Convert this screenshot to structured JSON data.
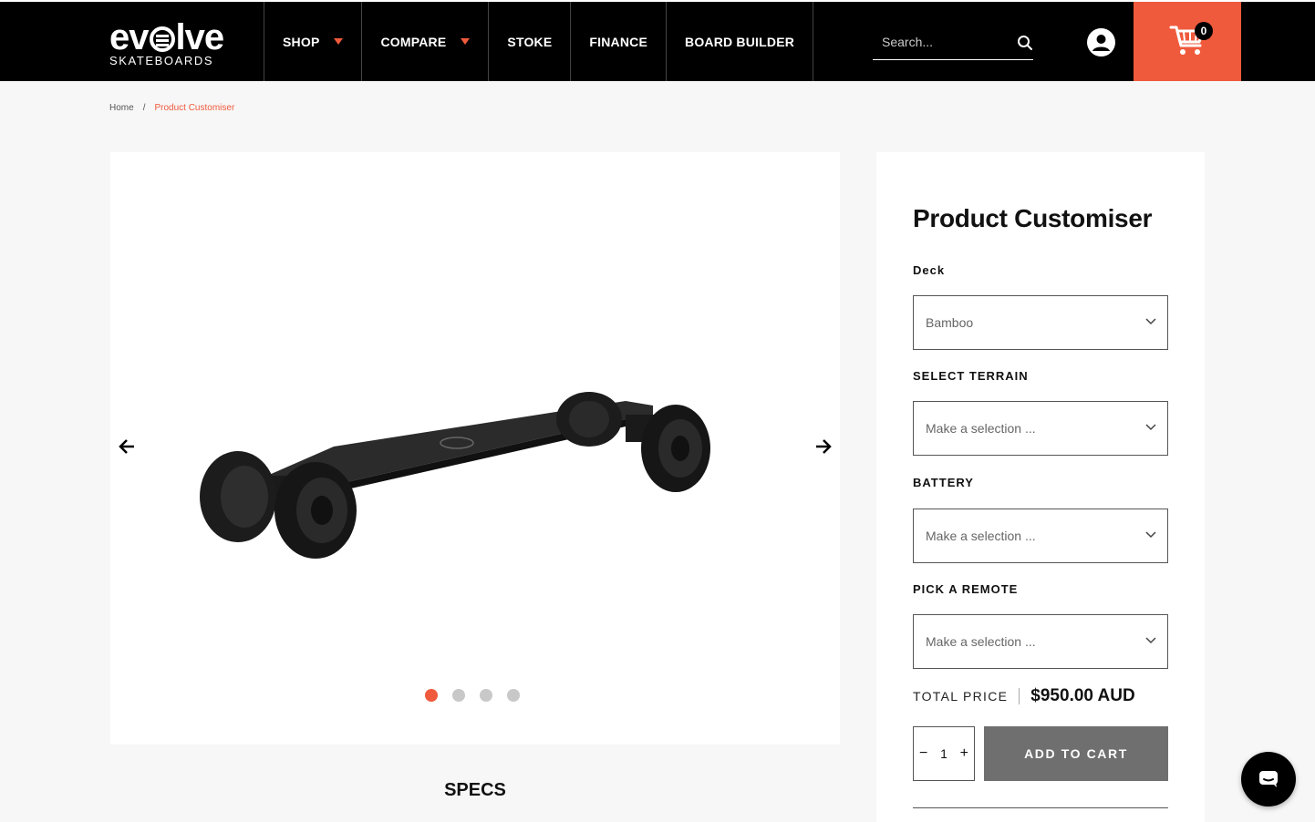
{
  "brand": {
    "name": "evolve",
    "sub": "SKATEBOARDS"
  },
  "nav": [
    {
      "label": "SHOP",
      "dropdown": true
    },
    {
      "label": "COMPARE",
      "dropdown": true
    },
    {
      "label": "STOKE",
      "dropdown": false
    },
    {
      "label": "FINANCE",
      "dropdown": false
    },
    {
      "label": "BOARD BUILDER",
      "dropdown": false
    }
  ],
  "search": {
    "placeholder": "Search..."
  },
  "cart": {
    "count": "0"
  },
  "breadcrumb": {
    "home": "Home",
    "separator": "/",
    "current": "Product Customiser"
  },
  "gallery": {
    "slides": 4,
    "active_slide": 1
  },
  "specs": {
    "heading": "SPECS"
  },
  "customiser": {
    "title": "Product Customiser",
    "fields": [
      {
        "label": "Deck",
        "value": "Bamboo"
      },
      {
        "label": "SELECT TERRAIN",
        "value": "Make a selection ..."
      },
      {
        "label": "BATTERY",
        "value": "Make a selection ..."
      },
      {
        "label": "PICK A REMOTE",
        "value": "Make a selection ..."
      }
    ],
    "total_label": "TOTAL PRICE",
    "total_price": "$950.00 AUD",
    "quantity": "1",
    "minus": "−",
    "plus": "+",
    "add_to_cart": "ADD TO CART"
  },
  "colors": {
    "accent": "#f05a3c",
    "header_bg": "#000000",
    "button_bg": "#6f6f6f"
  }
}
